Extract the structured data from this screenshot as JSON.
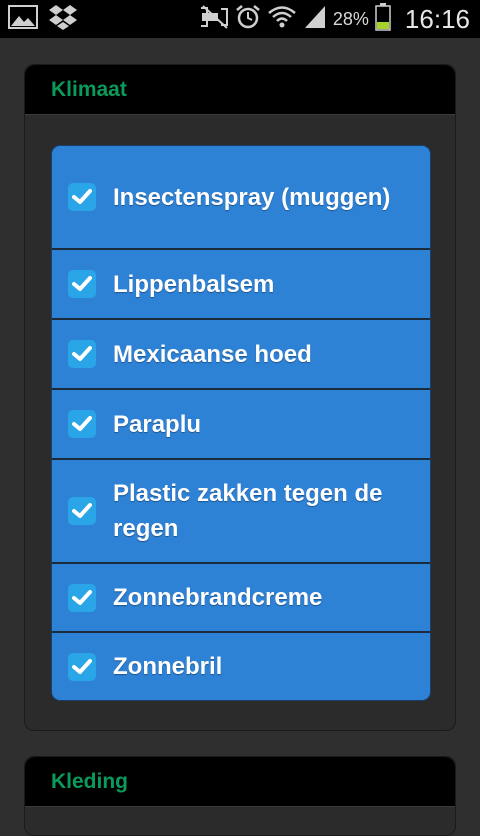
{
  "status_bar": {
    "battery_percent": "28%",
    "time": "16:16",
    "icons": [
      "gallery-icon",
      "dropbox-icon",
      "mute-icon",
      "alarm-icon",
      "wifi-icon",
      "signal-icon",
      "battery-icon"
    ]
  },
  "sections": [
    {
      "title": "Klimaat",
      "items": [
        {
          "label": "Insectenspray (muggen)",
          "checked": true
        },
        {
          "label": "Lippenbalsem",
          "checked": true
        },
        {
          "label": "Mexicaanse hoed",
          "checked": true
        },
        {
          "label": "Paraplu",
          "checked": true
        },
        {
          "label": "Plastic zakken tegen de regen",
          "checked": true
        },
        {
          "label": "Zonnebrandcreme",
          "checked": true
        },
        {
          "label": "Zonnebril",
          "checked": true
        }
      ]
    },
    {
      "title": "Kleding",
      "items": []
    }
  ],
  "colors": {
    "section_title": "#0a9a5a",
    "list_background": "#2e82d6",
    "checkbox": "#2aa5e8",
    "page_background": "#2f2f2f"
  }
}
